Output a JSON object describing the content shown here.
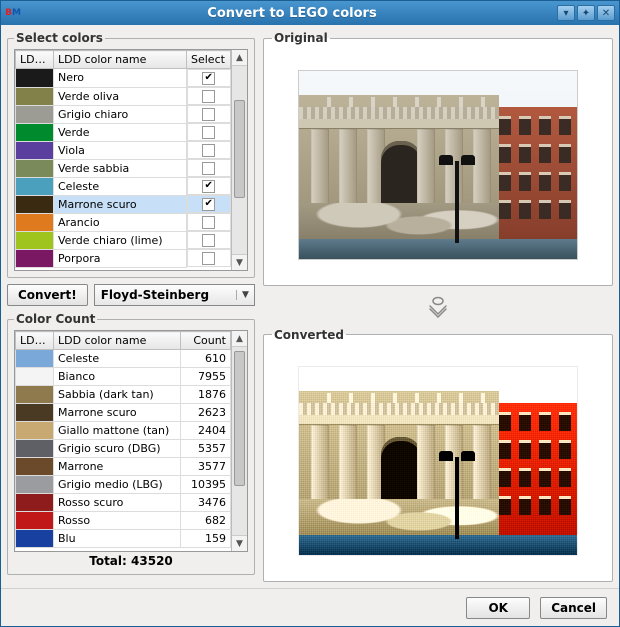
{
  "window": {
    "app_abbrev_b": "B",
    "app_abbrev_m": "M",
    "title": "Convert to LEGO colors"
  },
  "select_colors": {
    "legend": "Select colors",
    "headers": {
      "ldd": "LDD ...",
      "name": "LDD color name",
      "select": "Select"
    },
    "rows": [
      {
        "swatch": "#1a1a1a",
        "name": "Nero",
        "checked": true
      },
      {
        "swatch": "#83814a",
        "name": "Verde oliva",
        "checked": false
      },
      {
        "swatch": "#9c9c94",
        "name": "Grigio chiaro",
        "checked": false
      },
      {
        "swatch": "#008a2e",
        "name": "Verde",
        "checked": false
      },
      {
        "swatch": "#5a3f9e",
        "name": "Viola",
        "checked": false
      },
      {
        "swatch": "#7b8a5a",
        "name": "Verde sabbia",
        "checked": false
      },
      {
        "swatch": "#4aa0bd",
        "name": "Celeste",
        "checked": true
      },
      {
        "swatch": "#3a2a12",
        "name": "Marrone scuro",
        "checked": true,
        "selected": true
      },
      {
        "swatch": "#e07a1e",
        "name": "Arancio",
        "checked": false
      },
      {
        "swatch": "#9fc41e",
        "name": "Verde chiaro (lime)",
        "checked": false
      },
      {
        "swatch": "#7a1863",
        "name": "Porpora",
        "checked": false
      }
    ]
  },
  "actions": {
    "convert": "Convert!",
    "dither_selected": "Floyd-Steinberg"
  },
  "color_count": {
    "legend": "Color Count",
    "headers": {
      "ldd": "LDD...",
      "name": "LDD color name",
      "count": "Count"
    },
    "rows": [
      {
        "swatch": "#7aa8d8",
        "name": "Celeste",
        "count": 610
      },
      {
        "swatch": "#f4f4f4",
        "name": "Bianco",
        "count": 7955
      },
      {
        "swatch": "#8f7a4d",
        "name": "Sabbia (dark tan)",
        "count": 1876
      },
      {
        "swatch": "#4a3a24",
        "name": "Marrone scuro",
        "count": 2623
      },
      {
        "swatch": "#c8a971",
        "name": "Giallo mattone (tan)",
        "count": 2404
      },
      {
        "swatch": "#5f6066",
        "name": "Grigio scuro (DBG)",
        "count": 5357
      },
      {
        "swatch": "#6a4a2a",
        "name": "Marrone",
        "count": 3577
      },
      {
        "swatch": "#9a9ca0",
        "name": "Grigio medio (LBG)",
        "count": 10395
      },
      {
        "swatch": "#8e1c1c",
        "name": "Rosso scuro",
        "count": 3476
      },
      {
        "swatch": "#c01818",
        "name": "Rosso",
        "count": 682
      },
      {
        "swatch": "#1840a0",
        "name": "Blu",
        "count": 159
      }
    ],
    "total_label": "Total:",
    "total_value": "43520"
  },
  "preview": {
    "original_label": "Original",
    "converted_label": "Converted"
  },
  "footer": {
    "ok": "OK",
    "cancel": "Cancel"
  }
}
